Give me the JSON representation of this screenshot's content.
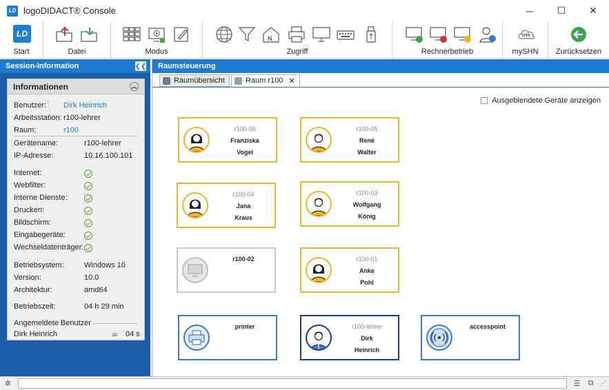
{
  "window": {
    "logo_text": "LD",
    "title": "logoDIDACT® Console"
  },
  "ribbon": {
    "groups": [
      {
        "label": "Start"
      },
      {
        "label": "Datei"
      },
      {
        "label": "Modus"
      },
      {
        "label": "Zugriff"
      },
      {
        "label": "Rechnerbetrieb"
      },
      {
        "label": "mySHN",
        "icon_text": "SHN"
      },
      {
        "label": "Zurücksetzen"
      }
    ]
  },
  "left": {
    "header": "Session-Information",
    "box_title": "Informationen",
    "benutzer_label": "Benutzer:",
    "benutzer_value": "Dirk Heinrich",
    "arbeitsstation_label": "Arbeitsstation:",
    "arbeitsstation_value": "r100-lehrer",
    "raum_label": "Raum:",
    "raum_value": "r100",
    "geraetename_label": "Gerätename:",
    "geraetename_value": "r100-lehrer",
    "ip_label": "IP-Adresse:",
    "ip_value": "10.16.100.101",
    "services": [
      "Internet:",
      "Webfilter:",
      "Interne Dienste:",
      "Drucken:",
      "Bildschirm:",
      "Eingabegeräte:",
      "Wechseldatenträger:"
    ],
    "os_label": "Betriebsystem:",
    "os_value": "Windows 10",
    "version_label": "Version:",
    "version_value": "10.0",
    "arch_label": "Architektur:",
    "arch_value": "amd64",
    "uptime_label": "Betriebszeit:",
    "uptime_value": "04 h 29 min",
    "users_header": "Angemeldete Benutzer",
    "user_name": "Dirk Heinrich",
    "user_idle": "04 s"
  },
  "right": {
    "header": "Raumsteuerung",
    "tabs": [
      {
        "label": "Raumübersicht"
      },
      {
        "label": "Raum r100"
      }
    ],
    "close_glyph": "✕",
    "show_hidden_label": "Ausgeblendete Geräte anzeigen"
  },
  "devices": [
    {
      "id": "r100-06",
      "first": "Franziska",
      "last": "Vogel",
      "type": "student-female"
    },
    {
      "id": "r100-05",
      "first": "René",
      "last": "Walter",
      "type": "student-male"
    },
    {
      "id": "r100-04",
      "first": "Jana",
      "last": "Kraus",
      "type": "student-female"
    },
    {
      "id": "r100-03",
      "first": "Wolfgang",
      "last": "König",
      "type": "student-male"
    },
    {
      "id": "r100-02",
      "first": "",
      "last": "",
      "type": "computer-offline"
    },
    {
      "id": "r100-01",
      "first": "Anke",
      "last": "Pohl",
      "type": "student-female"
    },
    {
      "id": "printer",
      "first": "",
      "last": "",
      "type": "printer"
    },
    {
      "id": "r100-lehrer",
      "first": "Dirk",
      "last": "Heinrich",
      "type": "teacher"
    },
    {
      "id": "accesspoint",
      "first": "",
      "last": "",
      "type": "accesspoint"
    }
  ],
  "colors": {
    "accent": "#1f7bd0",
    "panel": "#1a5fa8",
    "student": "#f0b429",
    "ok": "#5aa53a"
  }
}
